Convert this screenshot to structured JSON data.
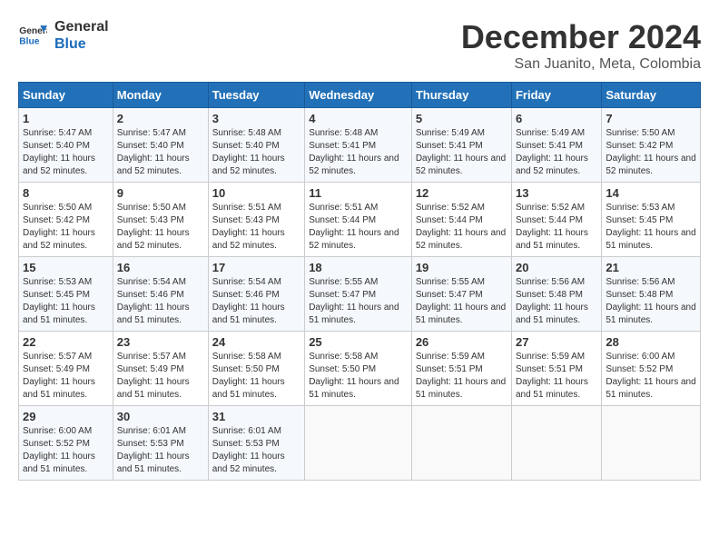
{
  "logo": {
    "line1": "General",
    "line2": "Blue"
  },
  "title": "December 2024",
  "location": "San Juanito, Meta, Colombia",
  "days_header": [
    "Sunday",
    "Monday",
    "Tuesday",
    "Wednesday",
    "Thursday",
    "Friday",
    "Saturday"
  ],
  "weeks": [
    [
      {
        "day": "1",
        "sunrise": "5:47 AM",
        "sunset": "5:40 PM",
        "daylight": "11 hours and 52 minutes."
      },
      {
        "day": "2",
        "sunrise": "5:47 AM",
        "sunset": "5:40 PM",
        "daylight": "11 hours and 52 minutes."
      },
      {
        "day": "3",
        "sunrise": "5:48 AM",
        "sunset": "5:40 PM",
        "daylight": "11 hours and 52 minutes."
      },
      {
        "day": "4",
        "sunrise": "5:48 AM",
        "sunset": "5:41 PM",
        "daylight": "11 hours and 52 minutes."
      },
      {
        "day": "5",
        "sunrise": "5:49 AM",
        "sunset": "5:41 PM",
        "daylight": "11 hours and 52 minutes."
      },
      {
        "day": "6",
        "sunrise": "5:49 AM",
        "sunset": "5:41 PM",
        "daylight": "11 hours and 52 minutes."
      },
      {
        "day": "7",
        "sunrise": "5:50 AM",
        "sunset": "5:42 PM",
        "daylight": "11 hours and 52 minutes."
      }
    ],
    [
      {
        "day": "8",
        "sunrise": "5:50 AM",
        "sunset": "5:42 PM",
        "daylight": "11 hours and 52 minutes."
      },
      {
        "day": "9",
        "sunrise": "5:50 AM",
        "sunset": "5:43 PM",
        "daylight": "11 hours and 52 minutes."
      },
      {
        "day": "10",
        "sunrise": "5:51 AM",
        "sunset": "5:43 PM",
        "daylight": "11 hours and 52 minutes."
      },
      {
        "day": "11",
        "sunrise": "5:51 AM",
        "sunset": "5:44 PM",
        "daylight": "11 hours and 52 minutes."
      },
      {
        "day": "12",
        "sunrise": "5:52 AM",
        "sunset": "5:44 PM",
        "daylight": "11 hours and 52 minutes."
      },
      {
        "day": "13",
        "sunrise": "5:52 AM",
        "sunset": "5:44 PM",
        "daylight": "11 hours and 51 minutes."
      },
      {
        "day": "14",
        "sunrise": "5:53 AM",
        "sunset": "5:45 PM",
        "daylight": "11 hours and 51 minutes."
      }
    ],
    [
      {
        "day": "15",
        "sunrise": "5:53 AM",
        "sunset": "5:45 PM",
        "daylight": "11 hours and 51 minutes."
      },
      {
        "day": "16",
        "sunrise": "5:54 AM",
        "sunset": "5:46 PM",
        "daylight": "11 hours and 51 minutes."
      },
      {
        "day": "17",
        "sunrise": "5:54 AM",
        "sunset": "5:46 PM",
        "daylight": "11 hours and 51 minutes."
      },
      {
        "day": "18",
        "sunrise": "5:55 AM",
        "sunset": "5:47 PM",
        "daylight": "11 hours and 51 minutes."
      },
      {
        "day": "19",
        "sunrise": "5:55 AM",
        "sunset": "5:47 PM",
        "daylight": "11 hours and 51 minutes."
      },
      {
        "day": "20",
        "sunrise": "5:56 AM",
        "sunset": "5:48 PM",
        "daylight": "11 hours and 51 minutes."
      },
      {
        "day": "21",
        "sunrise": "5:56 AM",
        "sunset": "5:48 PM",
        "daylight": "11 hours and 51 minutes."
      }
    ],
    [
      {
        "day": "22",
        "sunrise": "5:57 AM",
        "sunset": "5:49 PM",
        "daylight": "11 hours and 51 minutes."
      },
      {
        "day": "23",
        "sunrise": "5:57 AM",
        "sunset": "5:49 PM",
        "daylight": "11 hours and 51 minutes."
      },
      {
        "day": "24",
        "sunrise": "5:58 AM",
        "sunset": "5:50 PM",
        "daylight": "11 hours and 51 minutes."
      },
      {
        "day": "25",
        "sunrise": "5:58 AM",
        "sunset": "5:50 PM",
        "daylight": "11 hours and 51 minutes."
      },
      {
        "day": "26",
        "sunrise": "5:59 AM",
        "sunset": "5:51 PM",
        "daylight": "11 hours and 51 minutes."
      },
      {
        "day": "27",
        "sunrise": "5:59 AM",
        "sunset": "5:51 PM",
        "daylight": "11 hours and 51 minutes."
      },
      {
        "day": "28",
        "sunrise": "6:00 AM",
        "sunset": "5:52 PM",
        "daylight": "11 hours and 51 minutes."
      }
    ],
    [
      {
        "day": "29",
        "sunrise": "6:00 AM",
        "sunset": "5:52 PM",
        "daylight": "11 hours and 51 minutes."
      },
      {
        "day": "30",
        "sunrise": "6:01 AM",
        "sunset": "5:53 PM",
        "daylight": "11 hours and 51 minutes."
      },
      {
        "day": "31",
        "sunrise": "6:01 AM",
        "sunset": "5:53 PM",
        "daylight": "11 hours and 52 minutes."
      },
      null,
      null,
      null,
      null
    ]
  ]
}
